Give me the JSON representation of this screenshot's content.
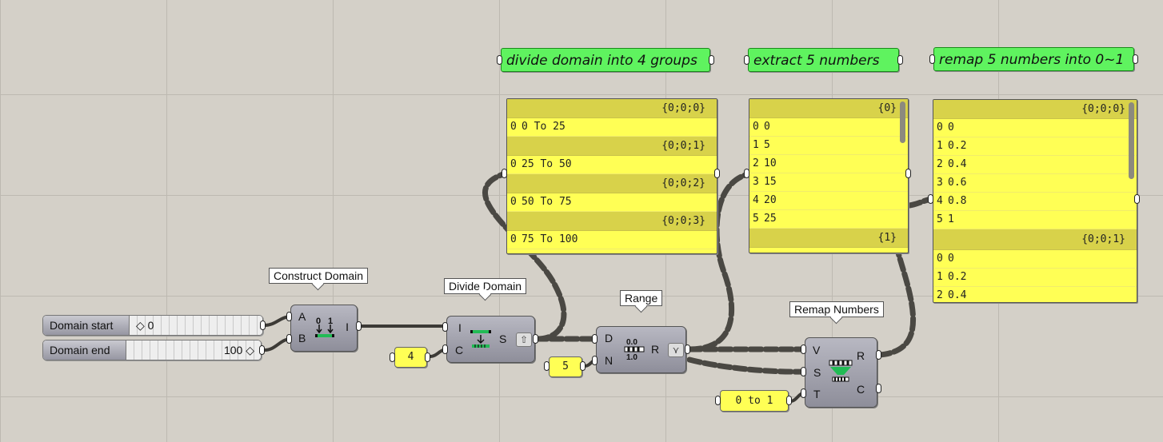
{
  "notes": [
    {
      "text": "divide domain into 4 groups"
    },
    {
      "text": "extract 5 numbers"
    },
    {
      "text": "remap 5 numbers into 0~1"
    }
  ],
  "panels": {
    "divide": {
      "groups": [
        {
          "path": "{0;0;0}",
          "rows": [
            {
              "i": "0",
              "v": "0 To 25"
            }
          ]
        },
        {
          "path": "{0;0;1}",
          "rows": [
            {
              "i": "0",
              "v": "25 To 50"
            }
          ]
        },
        {
          "path": "{0;0;2}",
          "rows": [
            {
              "i": "0",
              "v": "50 To 75"
            }
          ]
        },
        {
          "path": "{0;0;3}",
          "rows": [
            {
              "i": "0",
              "v": "75 To 100"
            }
          ]
        }
      ]
    },
    "extract": {
      "groups": [
        {
          "path": "{0}",
          "rows": [
            {
              "i": "0",
              "v": "0"
            },
            {
              "i": "1",
              "v": "5"
            },
            {
              "i": "2",
              "v": "10"
            },
            {
              "i": "3",
              "v": "15"
            },
            {
              "i": "4",
              "v": "20"
            },
            {
              "i": "5",
              "v": "25"
            }
          ]
        },
        {
          "path": "{1}",
          "rows": []
        }
      ]
    },
    "remap": {
      "groups": [
        {
          "path": "{0;0;0}",
          "rows": [
            {
              "i": "0",
              "v": "0"
            },
            {
              "i": "1",
              "v": "0.2"
            },
            {
              "i": "2",
              "v": "0.4"
            },
            {
              "i": "3",
              "v": "0.6"
            },
            {
              "i": "4",
              "v": "0.8"
            },
            {
              "i": "5",
              "v": "1"
            }
          ]
        },
        {
          "path": "{0;0;1}",
          "rows": [
            {
              "i": "0",
              "v": "0"
            },
            {
              "i": "1",
              "v": "0.2"
            },
            {
              "i": "2",
              "v": "0.4"
            }
          ]
        }
      ]
    }
  },
  "sliders": {
    "start": {
      "label": "Domain start",
      "value": "0"
    },
    "end": {
      "label": "Domain end",
      "value": "100"
    }
  },
  "components": {
    "construct": {
      "tooltip": "Construct Domain",
      "in": [
        "A",
        "B"
      ],
      "out": [
        "I"
      ],
      "icon": "construct-domain-icon"
    },
    "divide": {
      "tooltip": "Divide Domain",
      "in": [
        "I",
        "C"
      ],
      "out": [
        "S"
      ],
      "icon": "divide-domain-icon"
    },
    "range": {
      "tooltip": "Range",
      "in": [
        "D",
        "N"
      ],
      "out": [
        "R"
      ],
      "icon": "range-icon",
      "icon_text": [
        "0.0",
        "1.0"
      ]
    },
    "remap": {
      "tooltip": "Remap Numbers",
      "in": [
        "V",
        "S",
        "T"
      ],
      "out": [
        "R",
        "C"
      ],
      "icon": "remap-numbers-icon"
    }
  },
  "inputs": {
    "count": "4",
    "steps": "5",
    "target": "0 to 1"
  },
  "colors": {
    "canvas": "#d4d0c8",
    "note": "#5ff35f",
    "panel": "#ffff55",
    "panel_header": "#d8d24a",
    "component": "#9a9aa6"
  }
}
